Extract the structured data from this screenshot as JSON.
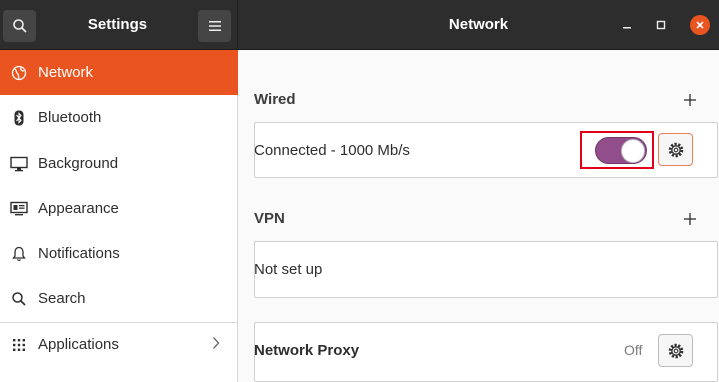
{
  "header": {
    "sidebar_title": "Settings",
    "main_title": "Network",
    "icons": {
      "search": "search-icon",
      "menu": "hamburger-menu-icon",
      "minimize": "minimize-icon",
      "maximize": "maximize-icon",
      "close": "close-icon"
    }
  },
  "sidebar": {
    "items": [
      {
        "label": "Network",
        "icon": "network-globe-icon",
        "active": true
      },
      {
        "label": "Bluetooth",
        "icon": "bluetooth-icon"
      },
      {
        "label": "Background",
        "icon": "background-monitor-icon"
      },
      {
        "label": "Appearance",
        "icon": "appearance-icon"
      },
      {
        "label": "Notifications",
        "icon": "bell-icon"
      },
      {
        "label": "Search",
        "icon": "search-icon"
      },
      {
        "label": "Applications",
        "icon": "grid-icon",
        "has_submenu": true
      }
    ]
  },
  "main": {
    "wired": {
      "title": "Wired",
      "connection_label": "Connected - 1000 Mb/s",
      "toggle_on": true
    },
    "vpn": {
      "title": "VPN",
      "status_label": "Not set up"
    },
    "proxy": {
      "label": "Network Proxy",
      "status": "Off"
    }
  },
  "colors": {
    "accent": "#e95420",
    "toggle_on": "#924d8b",
    "header_bg": "#2d2d2d",
    "highlight": "#e0001b"
  }
}
